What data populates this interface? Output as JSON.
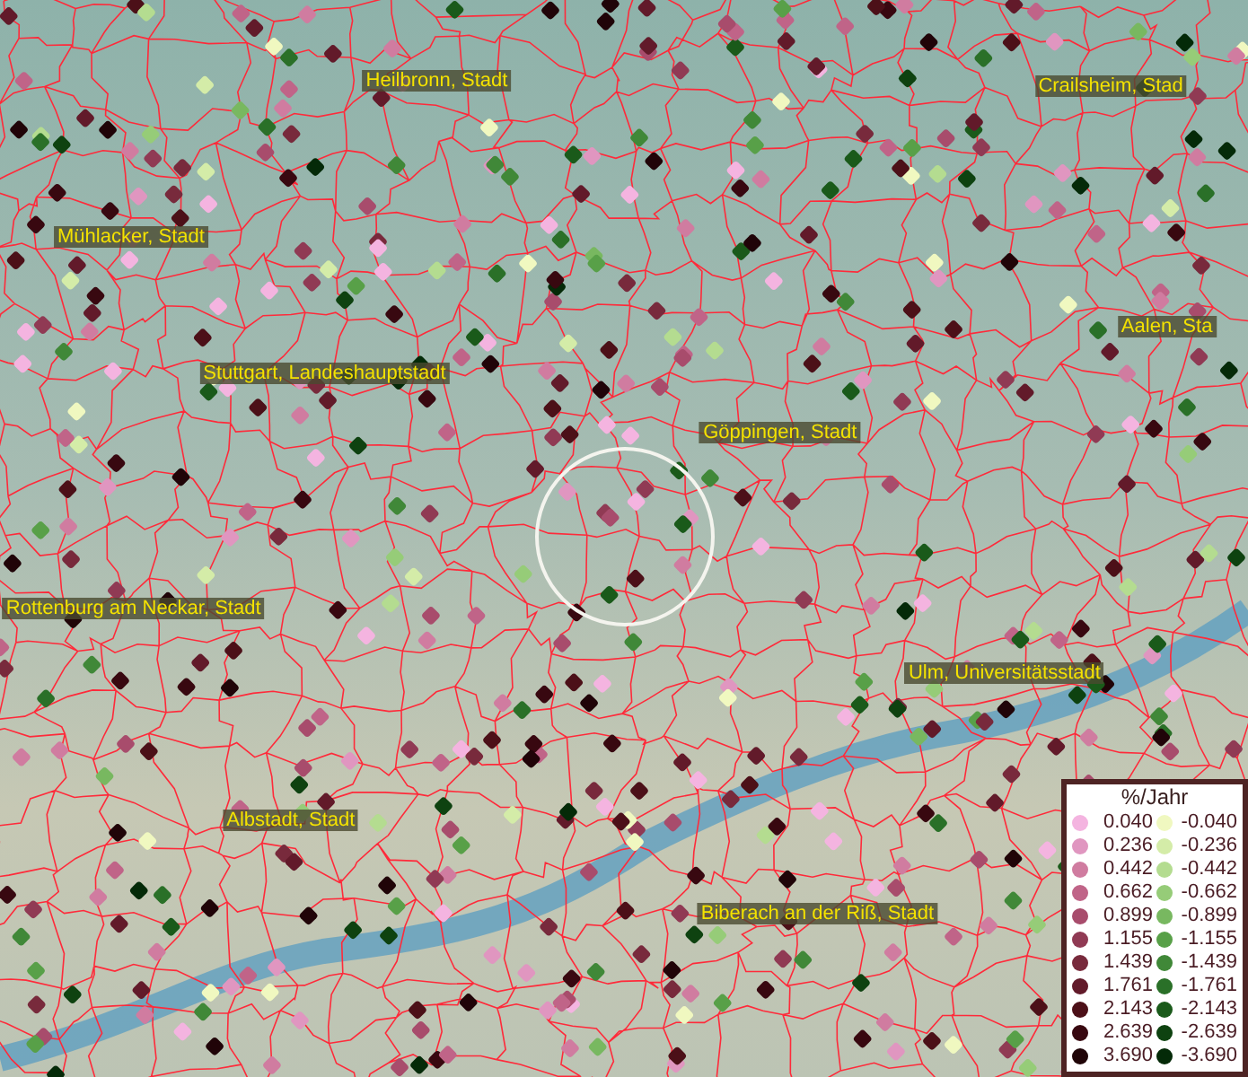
{
  "map": {
    "places": [
      {
        "name": "Heilbronn, Stadt"
      },
      {
        "name": "Crailsheim, Stad"
      },
      {
        "name": "Mühlacker, Stadt"
      },
      {
        "name": "Aalen, Sta"
      },
      {
        "name": "Stuttgart, Landeshauptstadt"
      },
      {
        "name": "Göppingen, Stadt"
      },
      {
        "name": "Rottenburg am Neckar, Stadt"
      },
      {
        "name": "Ulm, Universitätsstadt"
      },
      {
        "name": "Albstadt, Stadt"
      },
      {
        "name": "Biberach an der Riß, Stadt"
      }
    ]
  },
  "legend": {
    "title": "%/Jahr",
    "columns": [
      [
        {
          "label": "0.040",
          "color": "#f4b4e0"
        },
        {
          "label": "0.236",
          "color": "#e096c0"
        },
        {
          "label": "0.442",
          "color": "#d07ca0"
        },
        {
          "label": "0.662",
          "color": "#c06488"
        },
        {
          "label": "0.899",
          "color": "#a84c6c"
        },
        {
          "label": "1.155",
          "color": "#903a54"
        },
        {
          "label": "1.439",
          "color": "#782a3c"
        },
        {
          "label": "1.761",
          "color": "#621a2a"
        },
        {
          "label": "2.143",
          "color": "#4c1018"
        },
        {
          "label": "2.639",
          "color": "#380810"
        },
        {
          "label": "3.690",
          "color": "#200408"
        }
      ],
      [
        {
          "label": "-0.040",
          "color": "#f0f8c0"
        },
        {
          "label": "-0.236",
          "color": "#d4eca8"
        },
        {
          "label": "-0.442",
          "color": "#b4dc90"
        },
        {
          "label": "-0.662",
          "color": "#96cc78"
        },
        {
          "label": "-0.899",
          "color": "#78b860"
        },
        {
          "label": "-1.155",
          "color": "#58a048"
        },
        {
          "label": "-1.439",
          "color": "#408838"
        },
        {
          "label": "-1.761",
          "color": "#2a7028"
        },
        {
          "label": "-2.143",
          "color": "#1a5a1a"
        },
        {
          "label": "-2.639",
          "color": "#0e4210"
        },
        {
          "label": "-3.690",
          "color": "#042a08"
        }
      ]
    ]
  }
}
